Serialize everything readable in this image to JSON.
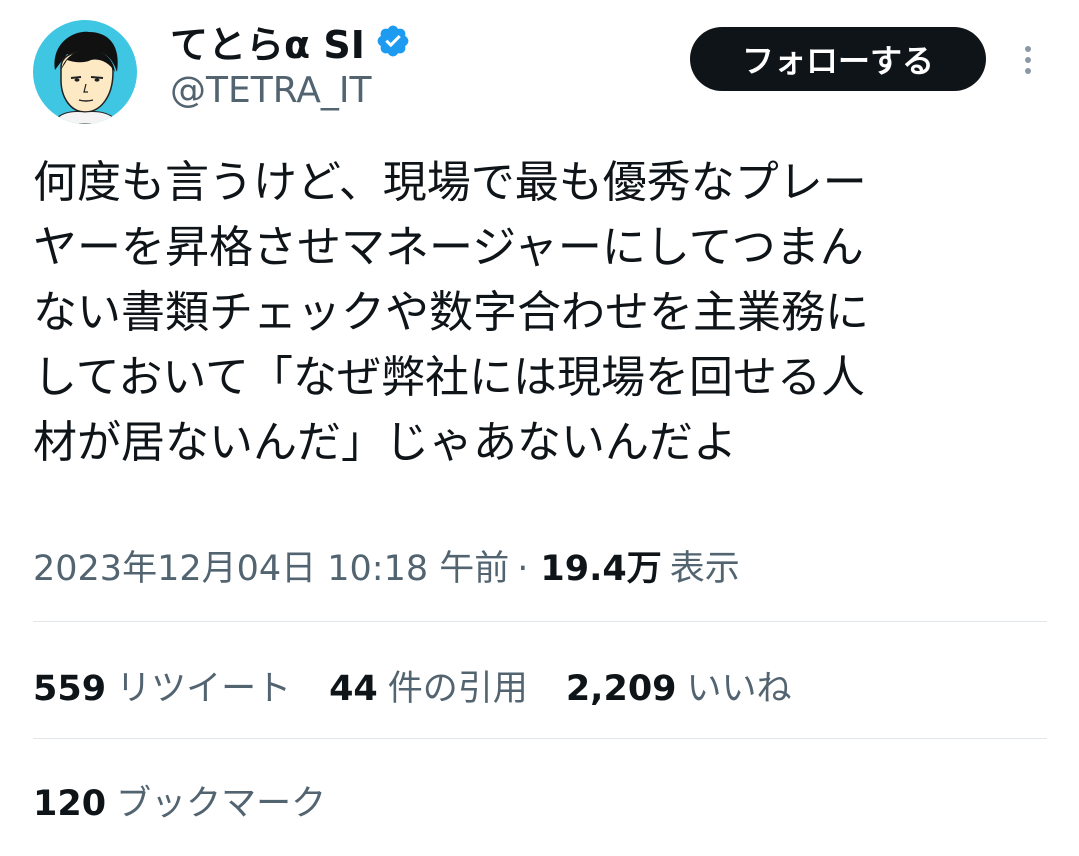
{
  "author": {
    "display_name": "てとらα SI",
    "handle": "@TETRA_IT",
    "verified": true,
    "avatar_colors": {
      "background": "#3fc6e3"
    }
  },
  "follow_button": {
    "label": "フォローする"
  },
  "tweet": {
    "lines": [
      "何度も言うけど、現場で最も優秀なプレー",
      "ヤーを昇格させマネージャーにしてつまん",
      "ない書類チェックや数字合わせを主業務に",
      "しておいて「なぜ弊社には現場を回せる人",
      "材が居ないんだ」じゃあないんだよ"
    ]
  },
  "meta": {
    "datetime": "2023年12月04日 10:18 午前",
    "separator": "·",
    "views_count": "19.4万",
    "views_label": "表示"
  },
  "stats": {
    "retweets": {
      "count": "559",
      "label": "リツイート"
    },
    "quotes": {
      "count": "44",
      "label": "件の引用"
    },
    "likes": {
      "count": "2,209",
      "label": "いいね"
    },
    "bookmarks": {
      "count": "120",
      "label": "ブックマーク"
    }
  },
  "colors": {
    "text_primary": "#0f1419",
    "text_secondary": "#536471",
    "verified_blue": "#1d9bf0",
    "button_bg": "#0f1419",
    "divider": "#e1e6ea"
  }
}
